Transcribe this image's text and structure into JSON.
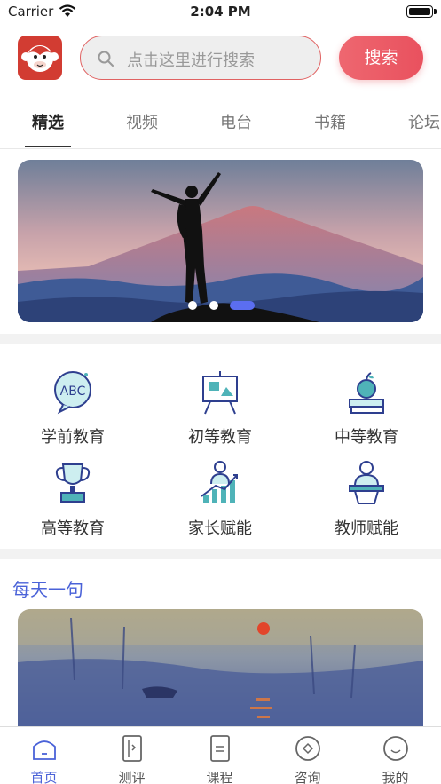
{
  "status_bar": {
    "carrier": "Carrier",
    "time": "2:04 PM"
  },
  "header": {
    "search_placeholder": "点击这里进行搜索",
    "search_button": "搜索"
  },
  "tabs": [
    {
      "label": "精选",
      "active": true
    },
    {
      "label": "视频",
      "active": false
    },
    {
      "label": "电台",
      "active": false
    },
    {
      "label": "书籍",
      "active": false
    },
    {
      "label": "论坛",
      "active": false
    }
  ],
  "banner": {
    "slide_count": 3,
    "active_slide": 3
  },
  "categories": [
    {
      "label": "学前教育",
      "icon": "abc-icon"
    },
    {
      "label": "初等教育",
      "icon": "easel-icon"
    },
    {
      "label": "中等教育",
      "icon": "apple-books-icon"
    },
    {
      "label": "高等教育",
      "icon": "trophy-icon"
    },
    {
      "label": "家长赋能",
      "icon": "growth-chart-icon"
    },
    {
      "label": "教师赋能",
      "icon": "teacher-podium-icon"
    }
  ],
  "daily": {
    "title": "每天一句"
  },
  "tabbar": [
    {
      "label": "首页",
      "icon": "home-icon",
      "active": true
    },
    {
      "label": "测评",
      "icon": "assessment-icon",
      "active": false
    },
    {
      "label": "课程",
      "icon": "course-icon",
      "active": false
    },
    {
      "label": "咨询",
      "icon": "consult-icon",
      "active": false
    },
    {
      "label": "我的",
      "icon": "profile-icon",
      "active": false
    }
  ],
  "colors": {
    "accent": "#4a62d8",
    "brand_red": "#e9515e"
  }
}
